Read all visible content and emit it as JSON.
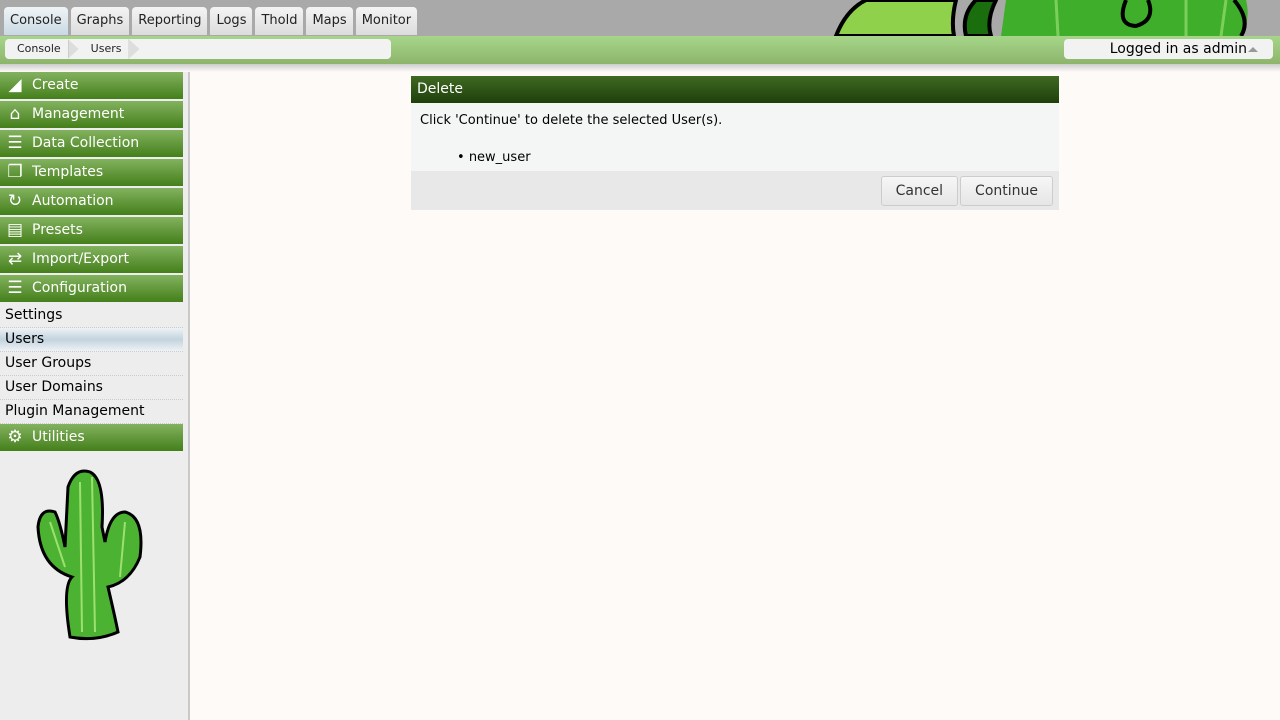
{
  "tabs": [
    "Console",
    "Graphs",
    "Reporting",
    "Logs",
    "Thold",
    "Maps",
    "Monitor"
  ],
  "active_tab": "Console",
  "breadcrumb": [
    "Console",
    "Users"
  ],
  "login": {
    "label": "Logged in as admin"
  },
  "sidebar": {
    "menus": [
      {
        "label": "Create",
        "icon": "area-chart-icon"
      },
      {
        "label": "Management",
        "icon": "home-icon"
      },
      {
        "label": "Data Collection",
        "icon": "database-icon"
      },
      {
        "label": "Templates",
        "icon": "copy-icon"
      },
      {
        "label": "Automation",
        "icon": "refresh-icon"
      },
      {
        "label": "Presets",
        "icon": "archive-icon"
      },
      {
        "label": "Import/Export",
        "icon": "exchange-icon"
      },
      {
        "label": "Configuration",
        "icon": "sliders-icon"
      }
    ],
    "subitems": [
      "Settings",
      "Users",
      "User Groups",
      "User Domains",
      "Plugin Management"
    ],
    "selected_subitem": "Users",
    "utilities": {
      "label": "Utilities",
      "icon": "gears-icon"
    }
  },
  "dialog": {
    "title": "Delete",
    "message": "Click 'Continue' to delete the selected User(s).",
    "items": [
      "new_user"
    ],
    "cancel_label": "Cancel",
    "continue_label": "Continue"
  },
  "colors": {
    "menu_green": "#447f1a",
    "title_green": "#1f3f0b",
    "breadcrumb_bar": "#a6d68a"
  }
}
